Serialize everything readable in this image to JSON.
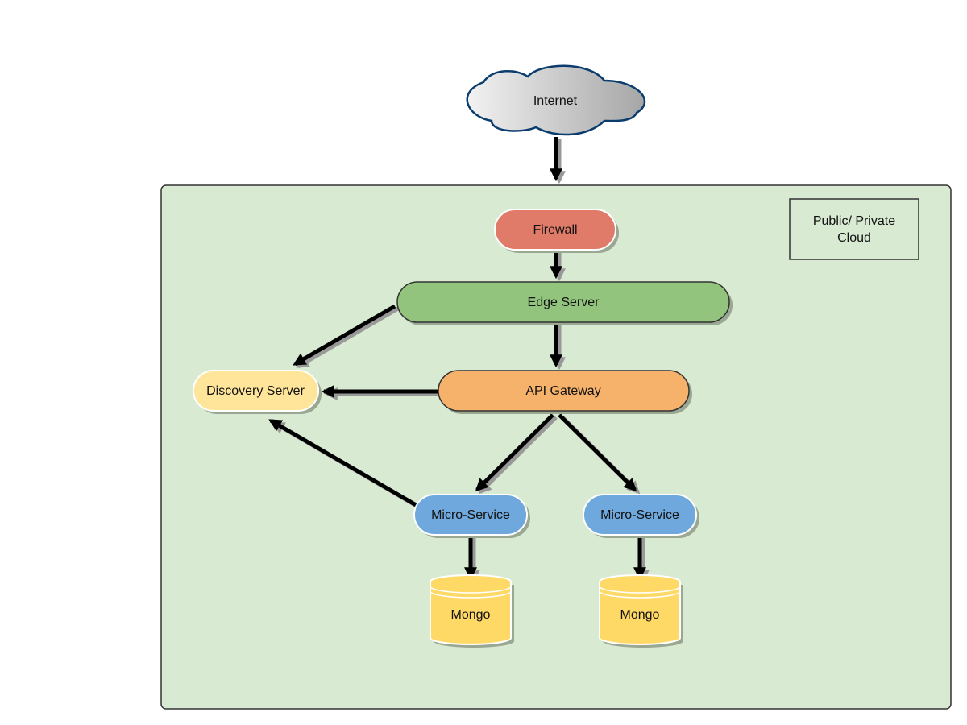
{
  "colors": {
    "container": "#d9ead3",
    "firewall": "#e07b6a",
    "edge_server": "#93c47d",
    "discovery_server": "#ffe599",
    "api_gateway": "#f6b26b",
    "micro_service": "#6fa8dc",
    "mongo": "#ffd966",
    "cloud_stroke": "#0b3c6e"
  },
  "nodes": {
    "internet": "Internet",
    "cloud_label_line1": "Public/ Private",
    "cloud_label_line2": "Cloud",
    "firewall": "Firewall",
    "edge_server": "Edge Server",
    "discovery_server": "Discovery Server",
    "api_gateway": "API Gateway",
    "micro_service_1": "Micro-Service",
    "micro_service_2": "Micro-Service",
    "mongo_1": "Mongo",
    "mongo_2": "Mongo"
  },
  "edges": [
    {
      "from": "Internet",
      "to": "Firewall"
    },
    {
      "from": "Firewall",
      "to": "Edge Server"
    },
    {
      "from": "Edge Server",
      "to": "API Gateway"
    },
    {
      "from": "Edge Server",
      "to": "Discovery Server"
    },
    {
      "from": "API Gateway",
      "to": "Discovery Server"
    },
    {
      "from": "Micro-Service",
      "to": "Discovery Server"
    },
    {
      "from": "API Gateway",
      "to": "Micro-Service"
    },
    {
      "from": "API Gateway",
      "to": "Micro-Service"
    },
    {
      "from": "Micro-Service",
      "to": "Mongo"
    },
    {
      "from": "Micro-Service",
      "to": "Mongo"
    }
  ]
}
